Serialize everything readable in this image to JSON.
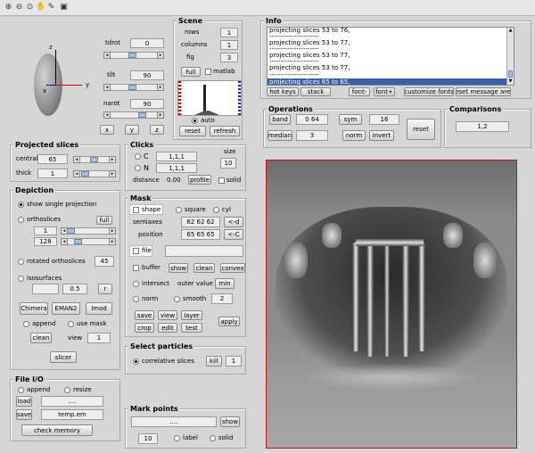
{
  "toolbar": {
    "icons": [
      "zoom-in",
      "zoom-out",
      "zoom-reset",
      "pan-hand",
      "data-cursor",
      "save"
    ]
  },
  "view3d": {
    "axis_z": "z",
    "axis_y": "y",
    "axis_x": "x",
    "tdrot_label": "tdrot",
    "tdrot_value": "0",
    "tilt_label": "tilt",
    "tilt_value": "90",
    "narot_label": "narot",
    "narot_value": "90",
    "btn_x": "x",
    "btn_y": "y",
    "btn_z": "z"
  },
  "scene": {
    "title": "Scene",
    "rows_label": "rows",
    "rows_value": "1",
    "columns_label": "columns",
    "columns_value": "1",
    "fig_label": "fig",
    "fig_value": "3",
    "full_button": "full",
    "matlab_label": "matlab",
    "auto_label": "auto",
    "reset_button": "reset",
    "refresh_button": "refresh"
  },
  "info": {
    "title": "Info",
    "messages": [
      "projecting slices 53 to 76,",
      "----------------------",
      "projecting slices 53 to 77,",
      "----------------------",
      "projecting slices 53 to 77,",
      "----------------------",
      "projecting slices 53 to 77,",
      "----------------------",
      "projecting slices 65 to 65,"
    ],
    "btn_hot_keys": "hot keys",
    "btn_stack": "stack",
    "btn_font_minus": "font-",
    "btn_font_plus": "font+",
    "btn_customize_fonts": "customize fonts",
    "btn_reset_message_area": "reset message area"
  },
  "operations": {
    "title": "Operations",
    "band_button": "band",
    "band_value": "0  64",
    "sym_button": "sym",
    "sym_value": "16",
    "median_button": "median",
    "median_value": "3",
    "norm_button": "norm",
    "invert_button": "invert",
    "reset_button": "reset"
  },
  "comparisons": {
    "title": "Comparisons",
    "value": "1,2"
  },
  "projected_slices": {
    "title": "Projected slices",
    "central_label": "central",
    "central_value": "65",
    "thick_label": "thick",
    "thick_value": "1"
  },
  "clicks": {
    "title": "Clicks",
    "c_label": "C",
    "c_value": "1,1,1",
    "n_label": "N",
    "n_value": "1,1,1",
    "size_label": "size",
    "size_value": "10",
    "distance_label": "distance",
    "distance_value": "0.00",
    "profile_button": "profile",
    "solid_label": "solid"
  },
  "depiction": {
    "title": "Depiction",
    "single_projection_label": "show single projection",
    "orthoslices_label": "orthoslices",
    "full_button": "full",
    "ortho_value1": "1",
    "ortho_value2": "128",
    "rotated_label": "rotated orthoslices",
    "rotated_value": "45",
    "isosurfaces_label": "isosurfaces",
    "iso_value": "0.5",
    "iso_r_button": "r",
    "chimera_button": "Chimera",
    "eman2_button": "EMAN2",
    "imod_button": "Imod",
    "append_label": "append",
    "use_mask_label": "use mask",
    "clean_button": "clean",
    "view_label": "view",
    "view_value": "1",
    "slicer_button": "slicer"
  },
  "mask": {
    "title": "Mask",
    "shape_label": "shape",
    "square_label": "square",
    "cyl_label": "cyl",
    "semiaxes_label": "semiaxes",
    "semiaxes_value": "62  62  62",
    "semiaxes_btn": "<-d",
    "position_label": "position",
    "position_value": "65  65  65",
    "position_btn": "<-C",
    "file_label": "file",
    "buffer_label": "buffer",
    "show_button": "show",
    "clean_button": "clean",
    "convex_button": "convex",
    "intersect_label": "intersect",
    "outer_value_label": "outer value",
    "min_button": "min",
    "norm_label": "norm",
    "smooth_label": "smooth",
    "smooth_value": "2",
    "save_button": "save",
    "view_button": "view",
    "layer_button": "layer",
    "crop_button": "crop",
    "edit_button": "edit",
    "test_button": "test",
    "apply_button": "apply"
  },
  "select_particles": {
    "title": "Select particles",
    "correlative_label": "correlative slices",
    "kill_button": "kill",
    "kill_value": "1"
  },
  "file_io": {
    "title": "File I/O",
    "append_label": "append",
    "resize_label": "resize",
    "load_button": "load",
    "load_value": "....",
    "save_button": "save",
    "save_value": "temp.em",
    "check_memory_button": "check memory"
  },
  "mark_points": {
    "title": "Mark points",
    "input_value": "....",
    "show_button": "show",
    "size_value": "10",
    "label_label": "label",
    "solid_label": "solid"
  },
  "colors": {
    "frame_red": "#cc1111",
    "selection_blue": "#3a5fa6",
    "hist_red": "#cc0000",
    "hist_blue": "#1030c0"
  }
}
